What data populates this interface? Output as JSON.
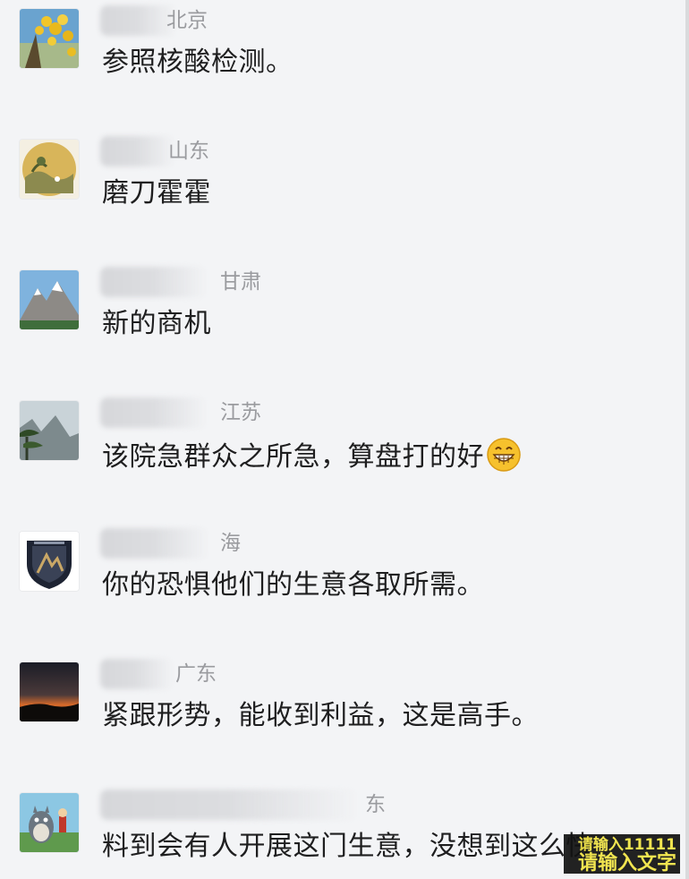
{
  "comments": [
    {
      "location": "北京",
      "text": "参照核酸检测。"
    },
    {
      "location": "山东",
      "text": "磨刀霍霍"
    },
    {
      "location": "甘肃",
      "text": "新的商机"
    },
    {
      "location": "江苏",
      "text": "该院急群众之所急，算盘打的好",
      "emoji": "grinning-face-emoji"
    },
    {
      "location": "海",
      "text": "你的恐惧他们的生意各取所需。"
    },
    {
      "location": "广东",
      "text": "紧跟形势，能收到利益，这是高手。"
    },
    {
      "location": "东",
      "text": "料到会有人开展这门生意，没想到这么快"
    }
  ],
  "watermark": {
    "line1": "请输入11111",
    "line2": "请输入文字"
  },
  "icons": {
    "avatar1": "yellow-flowers-avatar",
    "avatar2": "landscape-painting-avatar",
    "avatar3": "snow-mountain-avatar",
    "avatar4": "pine-cliff-avatar",
    "avatar5": "shield-emblem-avatar",
    "avatar6": "sunset-avatar",
    "avatar7": "totoro-avatar"
  }
}
